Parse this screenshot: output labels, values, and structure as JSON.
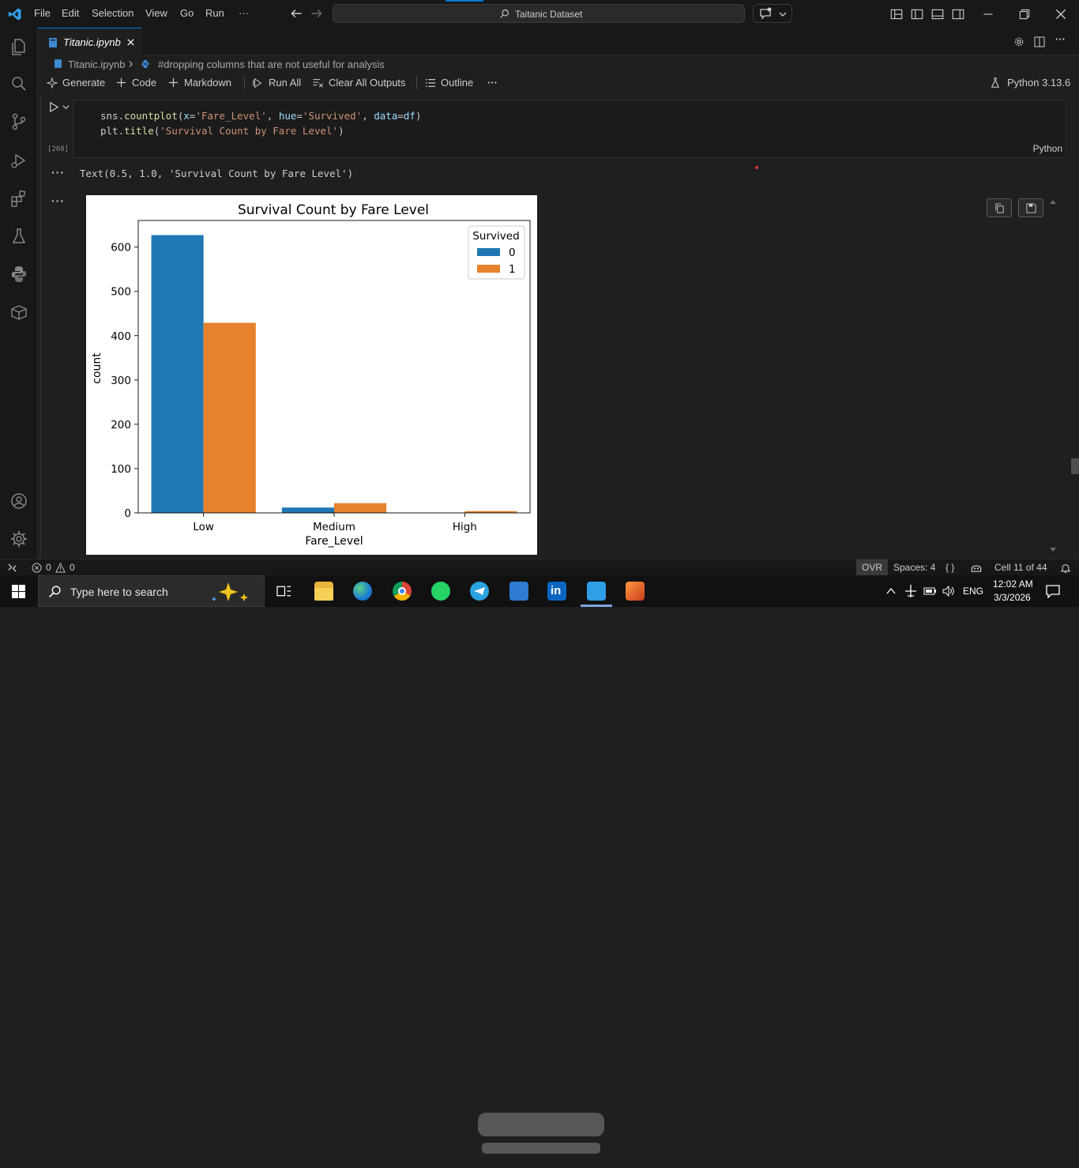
{
  "titlebar": {
    "menu": [
      "File",
      "Edit",
      "Selection",
      "View",
      "Go",
      "Run",
      "···"
    ],
    "search_text": "Taitanic Dataset"
  },
  "tabs": [
    {
      "label": "Titanic.ipynb"
    }
  ],
  "breadcrumb": {
    "file": "Titanic.ipynb",
    "cell": "#dropping columns that are not useful for analysis"
  },
  "toolbar": {
    "generate": "Generate",
    "code": "Code",
    "markdown": "Markdown",
    "run_all": "Run All",
    "clear_outputs": "Clear All Outputs",
    "outline": "Outline",
    "more": "···",
    "kernel": "Python 3.13.6"
  },
  "cell": {
    "line1": {
      "p1": "sns",
      "p2": ".",
      "p3": "countplot",
      "p4": "(",
      "p5": "x",
      "p6": "=",
      "p7": "'Fare_Level'",
      "p8": ", ",
      "p9": "hue",
      "p10": "=",
      "p11": "'Survived'",
      "p12": ", ",
      "p13": "data",
      "p14": "=",
      "p15": "df",
      "p16": ")"
    },
    "line2": {
      "p1": "plt",
      "p2": ".",
      "p3": "title",
      "p4": "(",
      "p5": "'Survival Count by Fare Level'",
      "p6": ")"
    },
    "exec_count": "[268]",
    "language": "Python"
  },
  "output": {
    "text": "Text(0.5, 1.0, 'Survival Count by Fare Level')",
    "ellipsis": "···"
  },
  "chart_data": {
    "type": "bar",
    "title": "Survival Count by Fare Level",
    "xlabel": "Fare_Level",
    "ylabel": "count",
    "categories": [
      "Low",
      "Medium",
      "High"
    ],
    "series": [
      {
        "name": "0",
        "values": [
          627,
          12,
          0
        ]
      },
      {
        "name": "1",
        "values": [
          429,
          22,
          4
        ]
      }
    ],
    "yticks": [
      0,
      100,
      200,
      300,
      400,
      500,
      600
    ],
    "ylim": [
      0,
      660
    ],
    "legend_title": "Survived",
    "legend_position": "top-right",
    "colors": [
      "#1f77b4",
      "#ff7f0e"
    ],
    "grid": false
  },
  "statusbar": {
    "errors": "0",
    "warnings": "0",
    "ovr": "OVR",
    "spaces": "Spaces: 4",
    "braces": "{ }",
    "cell_pos": "Cell 11 of 44"
  },
  "taskbar": {
    "search_placeholder": "Type here to search",
    "lang": "ENG",
    "time": "12:02 AM",
    "date": "3/3/2026"
  },
  "colors": {
    "accent": "#0078d4",
    "background": "#1f1f1f",
    "bar0": "#1f77b4",
    "bar1": "#e6822b"
  }
}
